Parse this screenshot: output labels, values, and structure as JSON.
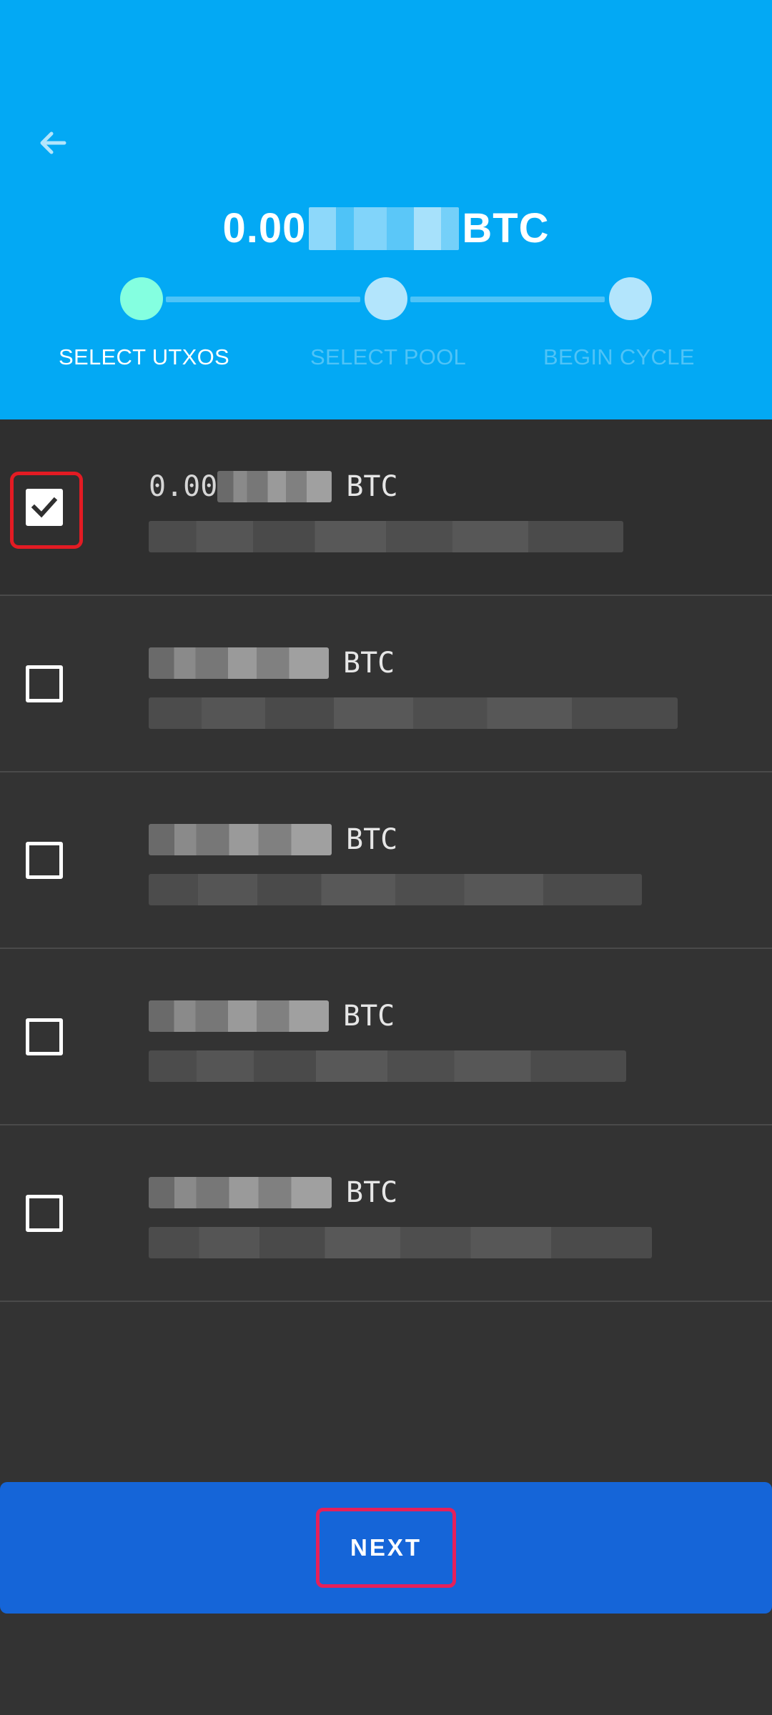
{
  "header": {
    "balance_prefix": "0.00",
    "balance_unit": "BTC",
    "steps": [
      {
        "label": "SELECT UTXOS",
        "active": true
      },
      {
        "label": "SELECT POOL",
        "active": false
      },
      {
        "label": "BEGIN CYCLE",
        "active": false
      }
    ]
  },
  "utxos": [
    {
      "amount_prefix": "0.00",
      "unit": "BTC",
      "checked": true
    },
    {
      "amount_prefix": "",
      "unit": "BTC",
      "checked": false
    },
    {
      "amount_prefix": "",
      "unit": "BTC",
      "checked": false
    },
    {
      "amount_prefix": "",
      "unit": "BTC",
      "checked": false
    },
    {
      "amount_prefix": "",
      "unit": "BTC",
      "checked": false
    }
  ],
  "footer": {
    "next_label": "NEXT"
  },
  "colors": {
    "header_bg": "#03A9F4",
    "active_step": "#84FFE0",
    "inactive_step": "#B3E5FC",
    "button_bg": "#1565D8",
    "highlight": "#E31B23"
  },
  "icons": {
    "back": "arrow-left-icon",
    "check": "check-icon"
  }
}
